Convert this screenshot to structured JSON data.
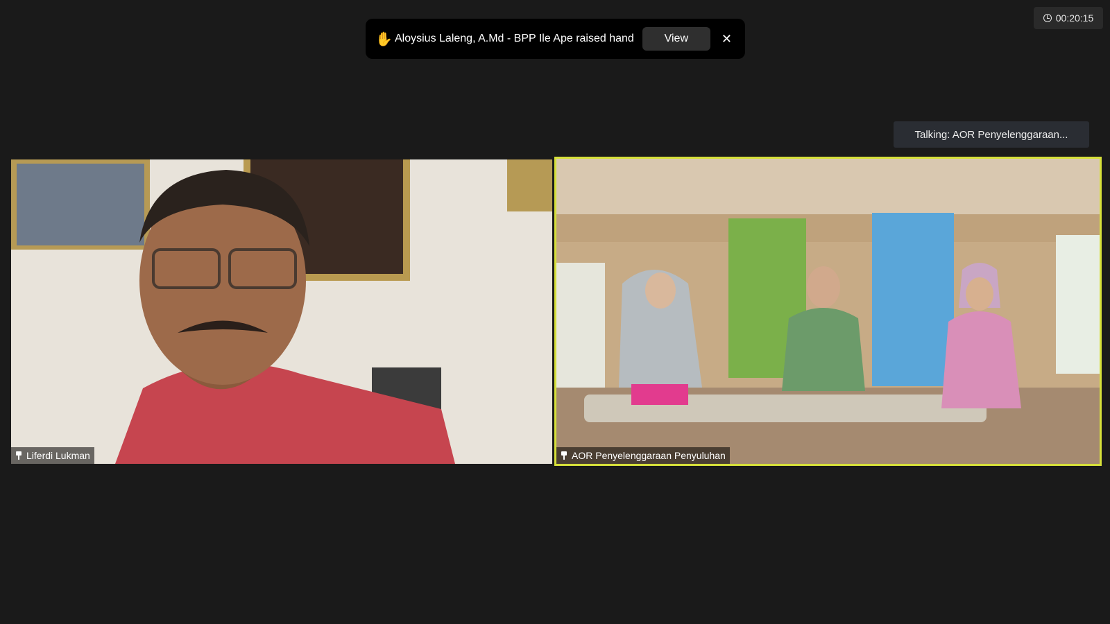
{
  "timer": {
    "text": "00:20:15",
    "icon": "clock-icon"
  },
  "notification": {
    "icon": "raised-hand-icon",
    "text": "Aloysius Laleng, A.Md - BPP Ile Ape raised hand",
    "view_label": "View",
    "close_label": "✕"
  },
  "talking_indicator": {
    "text": "Talking:  AOR  Penyelenggaraan..."
  },
  "participants": [
    {
      "name": "Liferdi Lukman",
      "pinned": true
    },
    {
      "name": "AOR Penyelenggaraan Penyuluhan",
      "pinned": true,
      "active_speaker": true
    }
  ],
  "colors": {
    "background": "#1a1a1a",
    "active_speaker_border": "#d6e03a",
    "toast_background": "#000000"
  }
}
